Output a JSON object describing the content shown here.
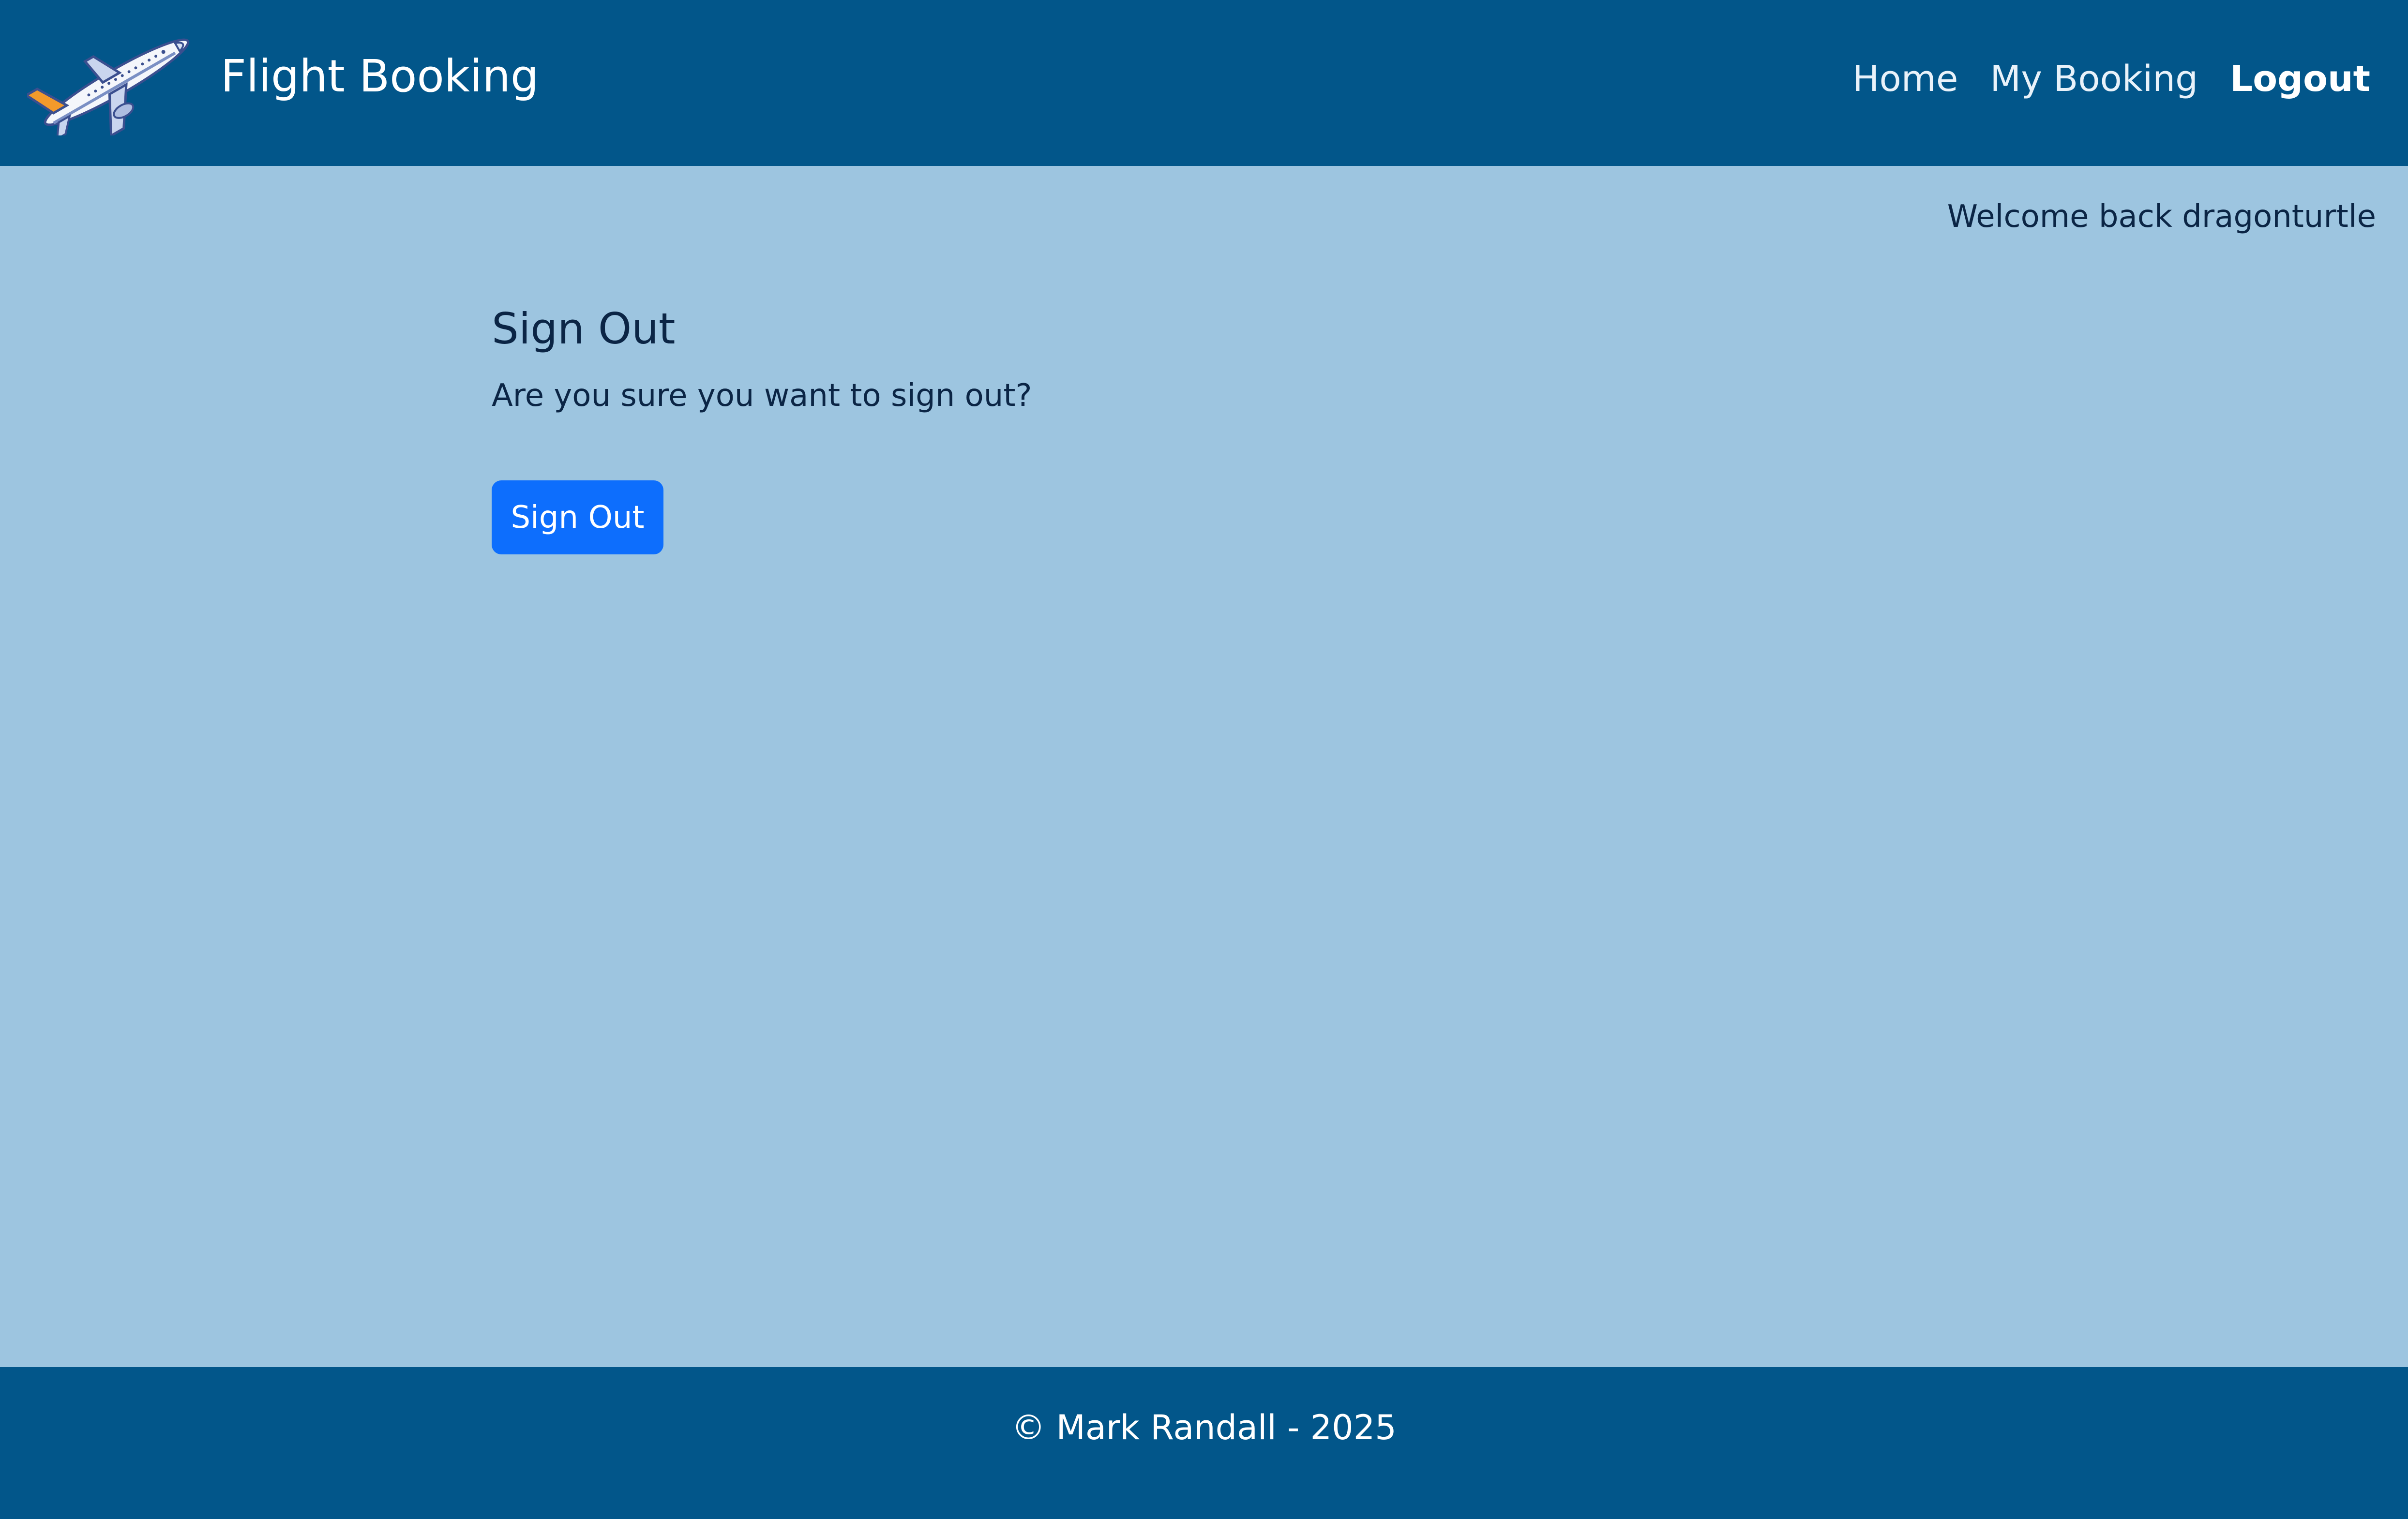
{
  "navbar": {
    "brand_title": "Flight Booking",
    "logo_icon": "airplane-icon",
    "links": [
      {
        "label": "Home"
      },
      {
        "label": "My Booking"
      },
      {
        "label": "Logout"
      }
    ]
  },
  "welcome_text": "Welcome back dragonturtle",
  "main": {
    "title": "Sign Out",
    "prompt": "Are you sure you want to sign out?",
    "button_label": "Sign Out"
  },
  "footer": {
    "text": "© Mark Randall - 2025"
  },
  "colors": {
    "header_footer": "#02568a",
    "page_background": "#9dc5e0",
    "button": "#0d6efd",
    "text_dark": "#0b2545"
  }
}
